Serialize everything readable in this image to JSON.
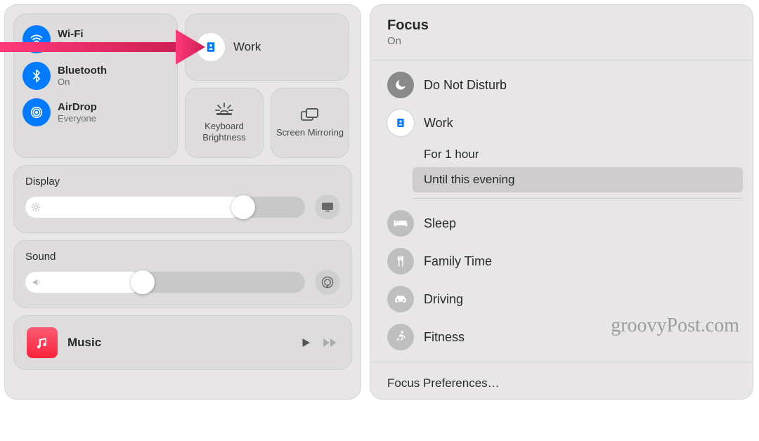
{
  "control_center": {
    "wifi": {
      "title": "Wi-Fi",
      "sub": "lion-luma"
    },
    "bluetooth": {
      "title": "Bluetooth",
      "sub": "On"
    },
    "airdrop": {
      "title": "AirDrop",
      "sub": "Everyone"
    },
    "focus_tile_label": "Work",
    "keyboard_brightness": "Keyboard Brightness",
    "screen_mirroring": "Screen Mirroring",
    "display": {
      "title": "Display",
      "value_pct": 78
    },
    "sound": {
      "title": "Sound",
      "value_pct": 42
    },
    "music": {
      "title": "Music"
    }
  },
  "focus_panel": {
    "title": "Focus",
    "status": "On",
    "items": [
      {
        "key": "dnd",
        "label": "Do Not Disturb"
      },
      {
        "key": "work",
        "label": "Work"
      },
      {
        "key": "sleep",
        "label": "Sleep"
      },
      {
        "key": "family",
        "label": "Family Time"
      },
      {
        "key": "driving",
        "label": "Driving"
      },
      {
        "key": "fitness",
        "label": "Fitness"
      }
    ],
    "work_options": {
      "opt1": "For 1 hour",
      "opt2": "Until this evening"
    },
    "preferences": "Focus Preferences…"
  },
  "watermark": "groovyPost.com"
}
